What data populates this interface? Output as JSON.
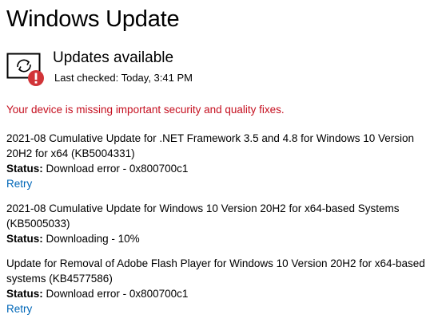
{
  "page": {
    "title": "Windows Update"
  },
  "status": {
    "heading": "Updates available",
    "last_checked": "Last checked: Today, 3:41 PM",
    "icon": "sync-error-icon",
    "error_badge_color": "#d13438"
  },
  "warning": {
    "text": "Your device is missing important security and quality fixes.",
    "color": "#c50f1f"
  },
  "labels": {
    "status_label": "Status:"
  },
  "updates": [
    {
      "title": "2021-08 Cumulative Update for .NET Framework 3.5 and 4.8 for Windows 10 Version 20H2 for x64 (KB5004331)",
      "status": "Download error - 0x800700c1",
      "action": "Retry"
    },
    {
      "title": "2021-08 Cumulative Update for Windows 10 Version 20H2 for x64-based Systems (KB5005033)",
      "status": "Downloading - 10%",
      "action": ""
    },
    {
      "title": "Update for Removal of Adobe Flash Player for Windows 10 Version 20H2 for x64-based systems (KB4577586)",
      "status": "Download error - 0x800700c1",
      "action": "Retry"
    }
  ],
  "colors": {
    "link": "#0067b8"
  }
}
